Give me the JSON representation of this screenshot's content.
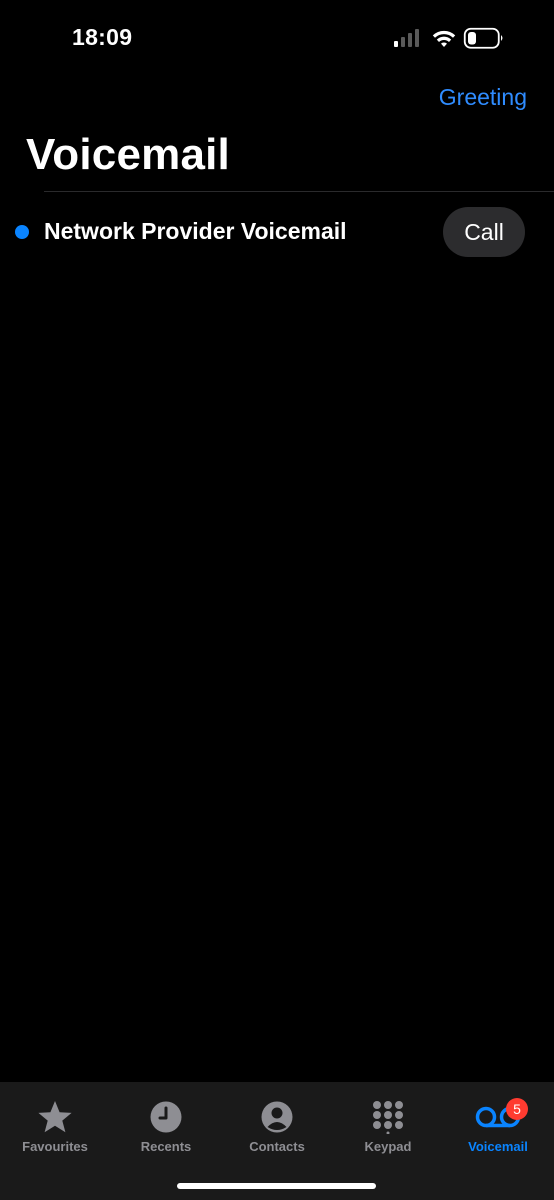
{
  "status_bar": {
    "time": "18:09",
    "icons": [
      "cellular-signal-icon",
      "wifi-icon",
      "battery-icon"
    ]
  },
  "header": {
    "greeting_label": "Greeting",
    "title": "Voicemail"
  },
  "voicemail_list": [
    {
      "name": "Network Provider Voicemail",
      "unread": true,
      "action_label": "Call"
    }
  ],
  "tab_bar": {
    "tabs": [
      {
        "label": "Favourites",
        "icon": "star-icon",
        "active": false
      },
      {
        "label": "Recents",
        "icon": "clock-icon",
        "active": false
      },
      {
        "label": "Contacts",
        "icon": "person-circle-icon",
        "active": false
      },
      {
        "label": "Keypad",
        "icon": "keypad-icon",
        "active": false
      },
      {
        "label": "Voicemail",
        "icon": "voicemail-icon",
        "active": true,
        "badge": "5"
      }
    ]
  },
  "colors": {
    "accent": "#0a84ff",
    "link": "#2f8cff",
    "badge": "#ff3b30",
    "background": "#000000",
    "tab_bar_background": "#1a1a1a",
    "inactive_tab": "#8e8e93"
  }
}
